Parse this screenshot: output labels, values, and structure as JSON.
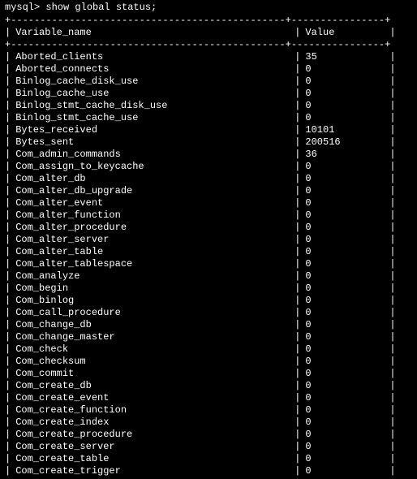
{
  "prompt": "mysql> show global status;",
  "header_border": "+-----------------------------------------------+----------------+",
  "column_headers": {
    "name": "Variable_name",
    "value": "Value"
  },
  "rows": [
    {
      "name": "Aborted_clients",
      "value": "35"
    },
    {
      "name": "Aborted_connects",
      "value": "0"
    },
    {
      "name": "Binlog_cache_disk_use",
      "value": "0"
    },
    {
      "name": "Binlog_cache_use",
      "value": "0"
    },
    {
      "name": "Binlog_stmt_cache_disk_use",
      "value": "0"
    },
    {
      "name": "Binlog_stmt_cache_use",
      "value": "0"
    },
    {
      "name": "Bytes_received",
      "value": "10101"
    },
    {
      "name": "Bytes_sent",
      "value": "200516"
    },
    {
      "name": "Com_admin_commands",
      "value": "36"
    },
    {
      "name": "Com_assign_to_keycache",
      "value": "0"
    },
    {
      "name": "Com_alter_db",
      "value": "0"
    },
    {
      "name": "Com_alter_db_upgrade",
      "value": "0"
    },
    {
      "name": "Com_alter_event",
      "value": "0"
    },
    {
      "name": "Com_alter_function",
      "value": "0"
    },
    {
      "name": "Com_alter_procedure",
      "value": "0"
    },
    {
      "name": "Com_alter_server",
      "value": "0"
    },
    {
      "name": "Com_alter_table",
      "value": "0"
    },
    {
      "name": "Com_alter_tablespace",
      "value": "0"
    },
    {
      "name": "Com_analyze",
      "value": "0"
    },
    {
      "name": "Com_begin",
      "value": "0"
    },
    {
      "name": "Com_binlog",
      "value": "0"
    },
    {
      "name": "Com_call_procedure",
      "value": "0"
    },
    {
      "name": "Com_change_db",
      "value": "0"
    },
    {
      "name": "Com_change_master",
      "value": "0"
    },
    {
      "name": "Com_check",
      "value": "0"
    },
    {
      "name": "Com_checksum",
      "value": "0"
    },
    {
      "name": "Com_commit",
      "value": "0"
    },
    {
      "name": "Com_create_db",
      "value": "0"
    },
    {
      "name": "Com_create_event",
      "value": "0"
    },
    {
      "name": "Com_create_function",
      "value": "0"
    },
    {
      "name": "Com_create_index",
      "value": "0"
    },
    {
      "name": "Com_create_procedure",
      "value": "0"
    },
    {
      "name": "Com_create_server",
      "value": "0"
    },
    {
      "name": "Com_create_table",
      "value": "0"
    },
    {
      "name": "Com_create_trigger",
      "value": "0"
    }
  ]
}
